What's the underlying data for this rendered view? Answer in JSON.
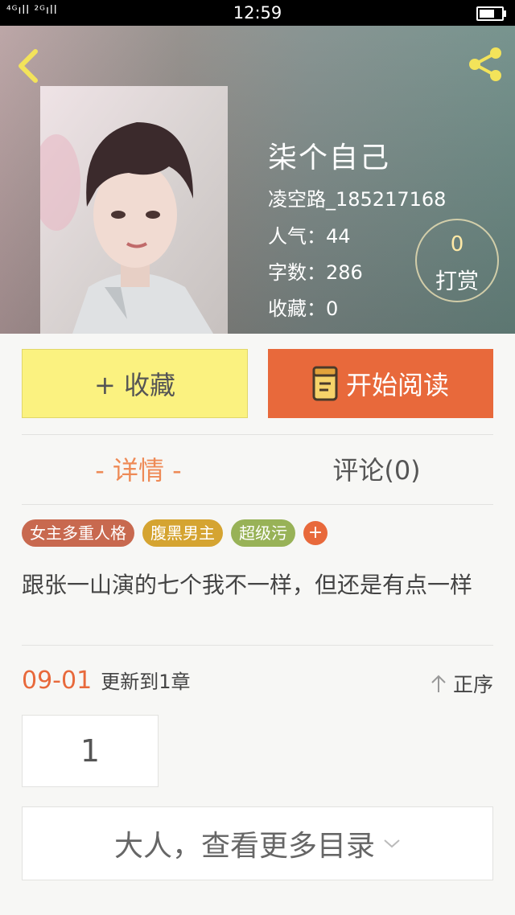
{
  "status_bar": {
    "signal": "⁴ᴳıll ²ᴳıll",
    "time": "12:59",
    "battery_level": 0.8
  },
  "book": {
    "title": "柒个自己",
    "author": "凌空路_185217168",
    "popularity": "人气：44",
    "word_count": "字数：286",
    "favorites": "收藏：0",
    "tip_count": "0",
    "tip_label": "打赏"
  },
  "actions": {
    "favorite_label": "+ 收藏",
    "read_label": "开始阅读"
  },
  "tabs": {
    "detail": "- 详情 -",
    "comments": "评论(0)"
  },
  "tags": [
    "女主多重人格",
    "腹黑男主",
    "超级污"
  ],
  "tag_add": "+",
  "description": "跟张一山演的七个我不一样，但还是有点一样",
  "update": {
    "date": "09-01",
    "text": "更新到1章",
    "sort_label": "正序"
  },
  "chapters": [
    "1"
  ],
  "more_catalog": "大人，查看更多目录",
  "colors": {
    "accent": "#e8693b",
    "favorite_bg": "#fbf280",
    "detail_tab": "#ee8a56"
  },
  "icons": [
    "back-icon",
    "share-icon",
    "book-icon",
    "sort-arrow-icon",
    "chevron-down-icon"
  ]
}
